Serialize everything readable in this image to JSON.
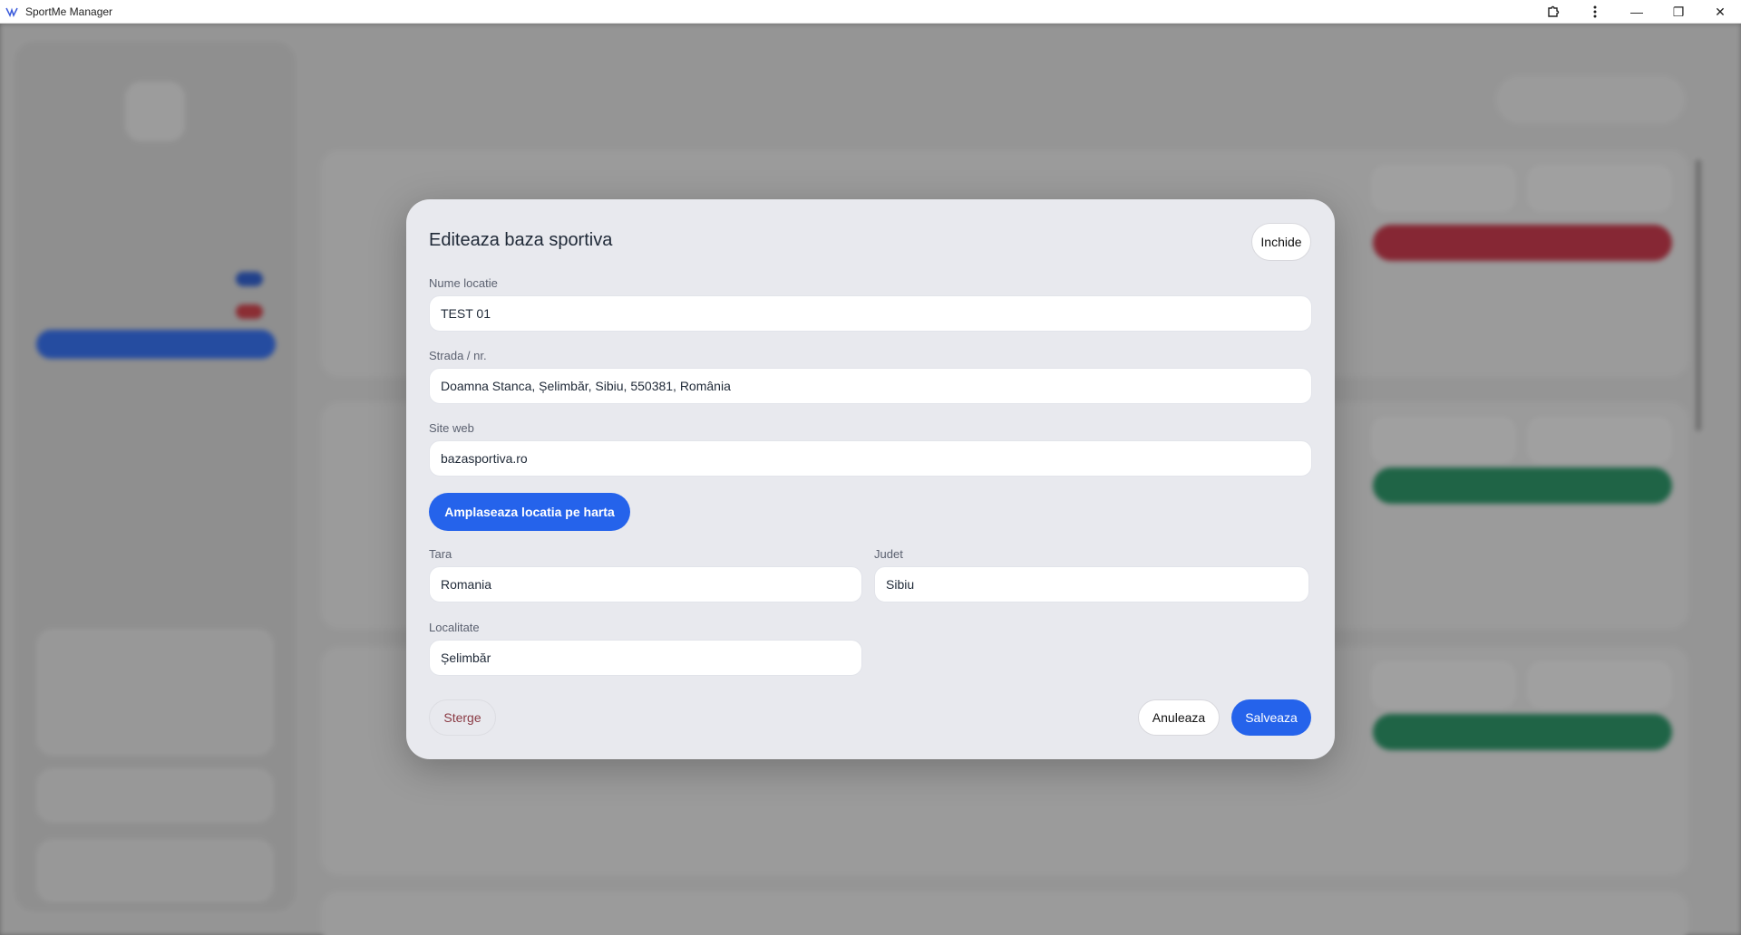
{
  "window": {
    "title": "SportMe Manager",
    "controls": {
      "extensions_icon": "puzzle-icon",
      "menu_icon": "more-vertical-icon",
      "minimize": "—",
      "restore": "❐",
      "close": "✕"
    }
  },
  "modal": {
    "title": "Editeaza baza sportiva",
    "close_label": "Inchide",
    "fields": {
      "name": {
        "label": "Nume locatie",
        "value": "TEST 01"
      },
      "street": {
        "label": "Strada / nr.",
        "value": "Doamna Stanca, Șelimbăr, Sibiu, 550381, România"
      },
      "website": {
        "label": "Site web",
        "value": "bazasportiva.ro"
      },
      "country": {
        "label": "Tara",
        "value": "Romania"
      },
      "county": {
        "label": "Judet",
        "value": "Sibiu"
      },
      "locality": {
        "label": "Localitate",
        "value": "Șelimbăr"
      }
    },
    "map_button": "Amplaseaza locatia pe harta",
    "delete_button": "Sterge",
    "cancel_button": "Anuleaza",
    "save_button": "Salveaza"
  },
  "colors": {
    "primary": "#2563eb",
    "danger": "#c0283c",
    "success": "#1a8a5a"
  }
}
